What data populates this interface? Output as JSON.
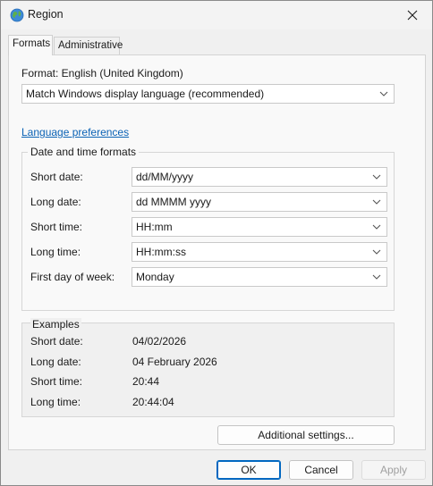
{
  "window": {
    "title": "Region",
    "close_icon": "close-icon",
    "app_icon": "globe-icon"
  },
  "tabs": [
    {
      "label": "Formats",
      "active": true
    },
    {
      "label": "Administrative",
      "active": false
    }
  ],
  "format": {
    "label": "Format: English (United Kingdom)",
    "value": "Match Windows display language (recommended)"
  },
  "language_link": "Language preferences",
  "date_time_formats": {
    "title": "Date and time formats",
    "rows": [
      {
        "label": "Short date:",
        "value": "dd/MM/yyyy"
      },
      {
        "label": "Long date:",
        "value": "dd MMMM yyyy"
      },
      {
        "label": "Short time:",
        "value": "HH:mm"
      },
      {
        "label": "Long time:",
        "value": "HH:mm:ss"
      },
      {
        "label": "First day of week:",
        "value": "Monday"
      }
    ]
  },
  "examples": {
    "title": "Examples",
    "rows": [
      {
        "label": "Short date:",
        "value": "04/02/2026"
      },
      {
        "label": "Long date:",
        "value": "04 February 2026"
      },
      {
        "label": "Short time:",
        "value": "20:44"
      },
      {
        "label": "Long time:",
        "value": "20:44:04"
      }
    ]
  },
  "buttons": {
    "additional": "Additional settings...",
    "ok": "OK",
    "cancel": "Cancel",
    "apply": "Apply"
  },
  "colors": {
    "link": "#0a62b5",
    "accent": "#0067c0"
  }
}
